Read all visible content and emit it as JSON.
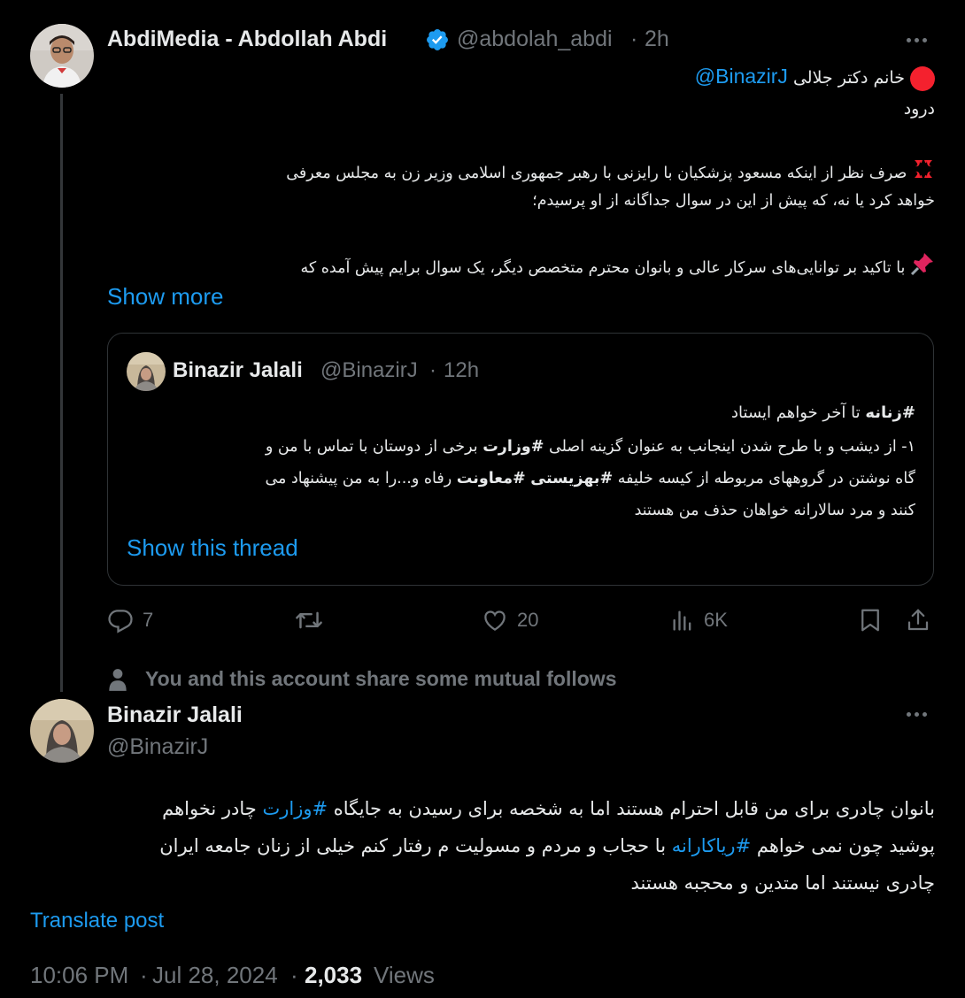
{
  "main_tweet": {
    "display_name": "AbdiMedia - Abdollah Abdi",
    "handle": "@abdolah_abdi",
    "separator": "·",
    "time": "2h",
    "mention": "@BinazirJ",
    "line1_text": "خانم دکتر جلالی",
    "line2": "درود",
    "line3": "صرف نظر از اینکه مسعود پزشکیان با رایزنی با رهبر جمهوری اسلامی وزیر زن به مجلس معرفی",
    "line4": "خواهد کرد یا نه، که پیش از این در سوال جداگانه از او پرسیدم؛",
    "line5": "با تاکید بر توانایی‌های سرکار عالی و بانوان محترم متخصص دیگر، یک سوال برایم پیش آمده که",
    "show_more": "Show more"
  },
  "quoted_tweet": {
    "display_name": "Binazir Jalali",
    "handle": "@BinazirJ",
    "separator": "·",
    "time": "12h",
    "line1_tag": "#زنانه",
    "line1_rest": " تا آخر خواهم ایستاد",
    "line2_a": "۱-  از دیشب و با طرح شدن اینجانب به عنوان گزینه اصلی ",
    "line2_tag": "#وزارت",
    "line2_b": " برخی از دوستان با تماس با من و",
    "line3_a": "گاه نوشتن در گروههای مربوطه از کیسه خلیفه ",
    "line3_tag1": "#بهزیستی",
    "line3_mid": " ",
    "line3_tag2": "#معاونت",
    "line3_b": " رفاه و...را به من پیشنهاد می",
    "line4": "کنند و مرد سالارانه خواهان حذف من هستند",
    "show_thread": "Show this thread"
  },
  "actions": {
    "replies": "7",
    "likes": "20",
    "views": "6K"
  },
  "mutual_follows": "You and this account share some mutual follows",
  "reply_tweet": {
    "display_name": "Binazir Jalali",
    "handle": "@BinazirJ",
    "line1_a": "بانوان چادری برای من قابل احترام هستند اما به شخصه برای رسیدن به جایگاه ",
    "line1_tag": "#وزارت",
    "line1_b": " چادر نخواهم",
    "line2_a": "پوشید چون نمی خواهم ",
    "line2_tag": "#ریاکارانه",
    "line2_b": " با حجاب و مردم و مسولیت م رفتار کنم خیلی از زنان جامعه ایران",
    "line3": "چادری نیستند  اما متدین و محجبه هستند",
    "translate": "Translate post",
    "time": "10:06 PM",
    "separator": "·",
    "date": "Jul 28, 2024",
    "views_count": "2,033",
    "views_label": "Views"
  },
  "colors": {
    "background": "#000000",
    "text": "#e7e9ea",
    "secondary": "#71767b",
    "link": "#1d9bf0",
    "border": "#2f3336"
  },
  "icons": [
    "verified-badge-icon",
    "more-icon",
    "red-circle-icon",
    "anger-icon",
    "pushpin-icon",
    "reply-icon",
    "retweet-icon",
    "like-icon",
    "views-icon",
    "bookmark-icon",
    "share-icon",
    "person-icon"
  ]
}
